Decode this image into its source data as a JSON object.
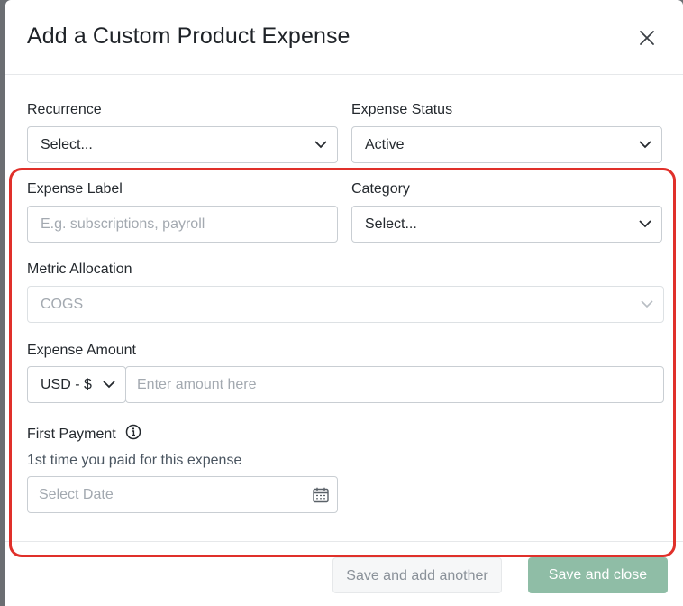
{
  "modal": {
    "title": "Add a Custom Product Expense"
  },
  "form": {
    "recurrence": {
      "label": "Recurrence",
      "value": "Select..."
    },
    "expense_status": {
      "label": "Expense Status",
      "value": "Active"
    },
    "expense_label": {
      "label": "Expense Label",
      "placeholder": "E.g. subscriptions, payroll"
    },
    "category": {
      "label": "Category",
      "value": "Select..."
    },
    "metric_allocation": {
      "label": "Metric Allocation",
      "value": "COGS"
    },
    "expense_amount": {
      "label": "Expense Amount",
      "currency": "USD - $",
      "placeholder": "Enter amount here"
    },
    "first_payment": {
      "label": "First Payment",
      "hint": "1st time you paid for this expense",
      "placeholder": "Select Date"
    }
  },
  "footer": {
    "save_add_another": "Save and add another",
    "save_close": "Save and close"
  },
  "colors": {
    "highlight": "#e0302a",
    "primary_button": "#8fbda6"
  },
  "icons": [
    "close-icon",
    "chevron-down-icon",
    "info-icon",
    "calendar-icon"
  ]
}
